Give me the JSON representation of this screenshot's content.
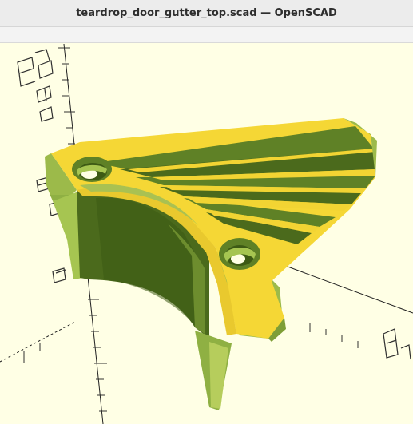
{
  "window": {
    "title": "teardrop_door_gutter_top.scad — OpenSCAD"
  },
  "viewport": {
    "background_color": "#ffffe5",
    "model_face_color": "#f5d735",
    "model_side_color": "#9cba4a",
    "model_shadow_color": "#4b6a1c",
    "axis_color": "#202020"
  }
}
